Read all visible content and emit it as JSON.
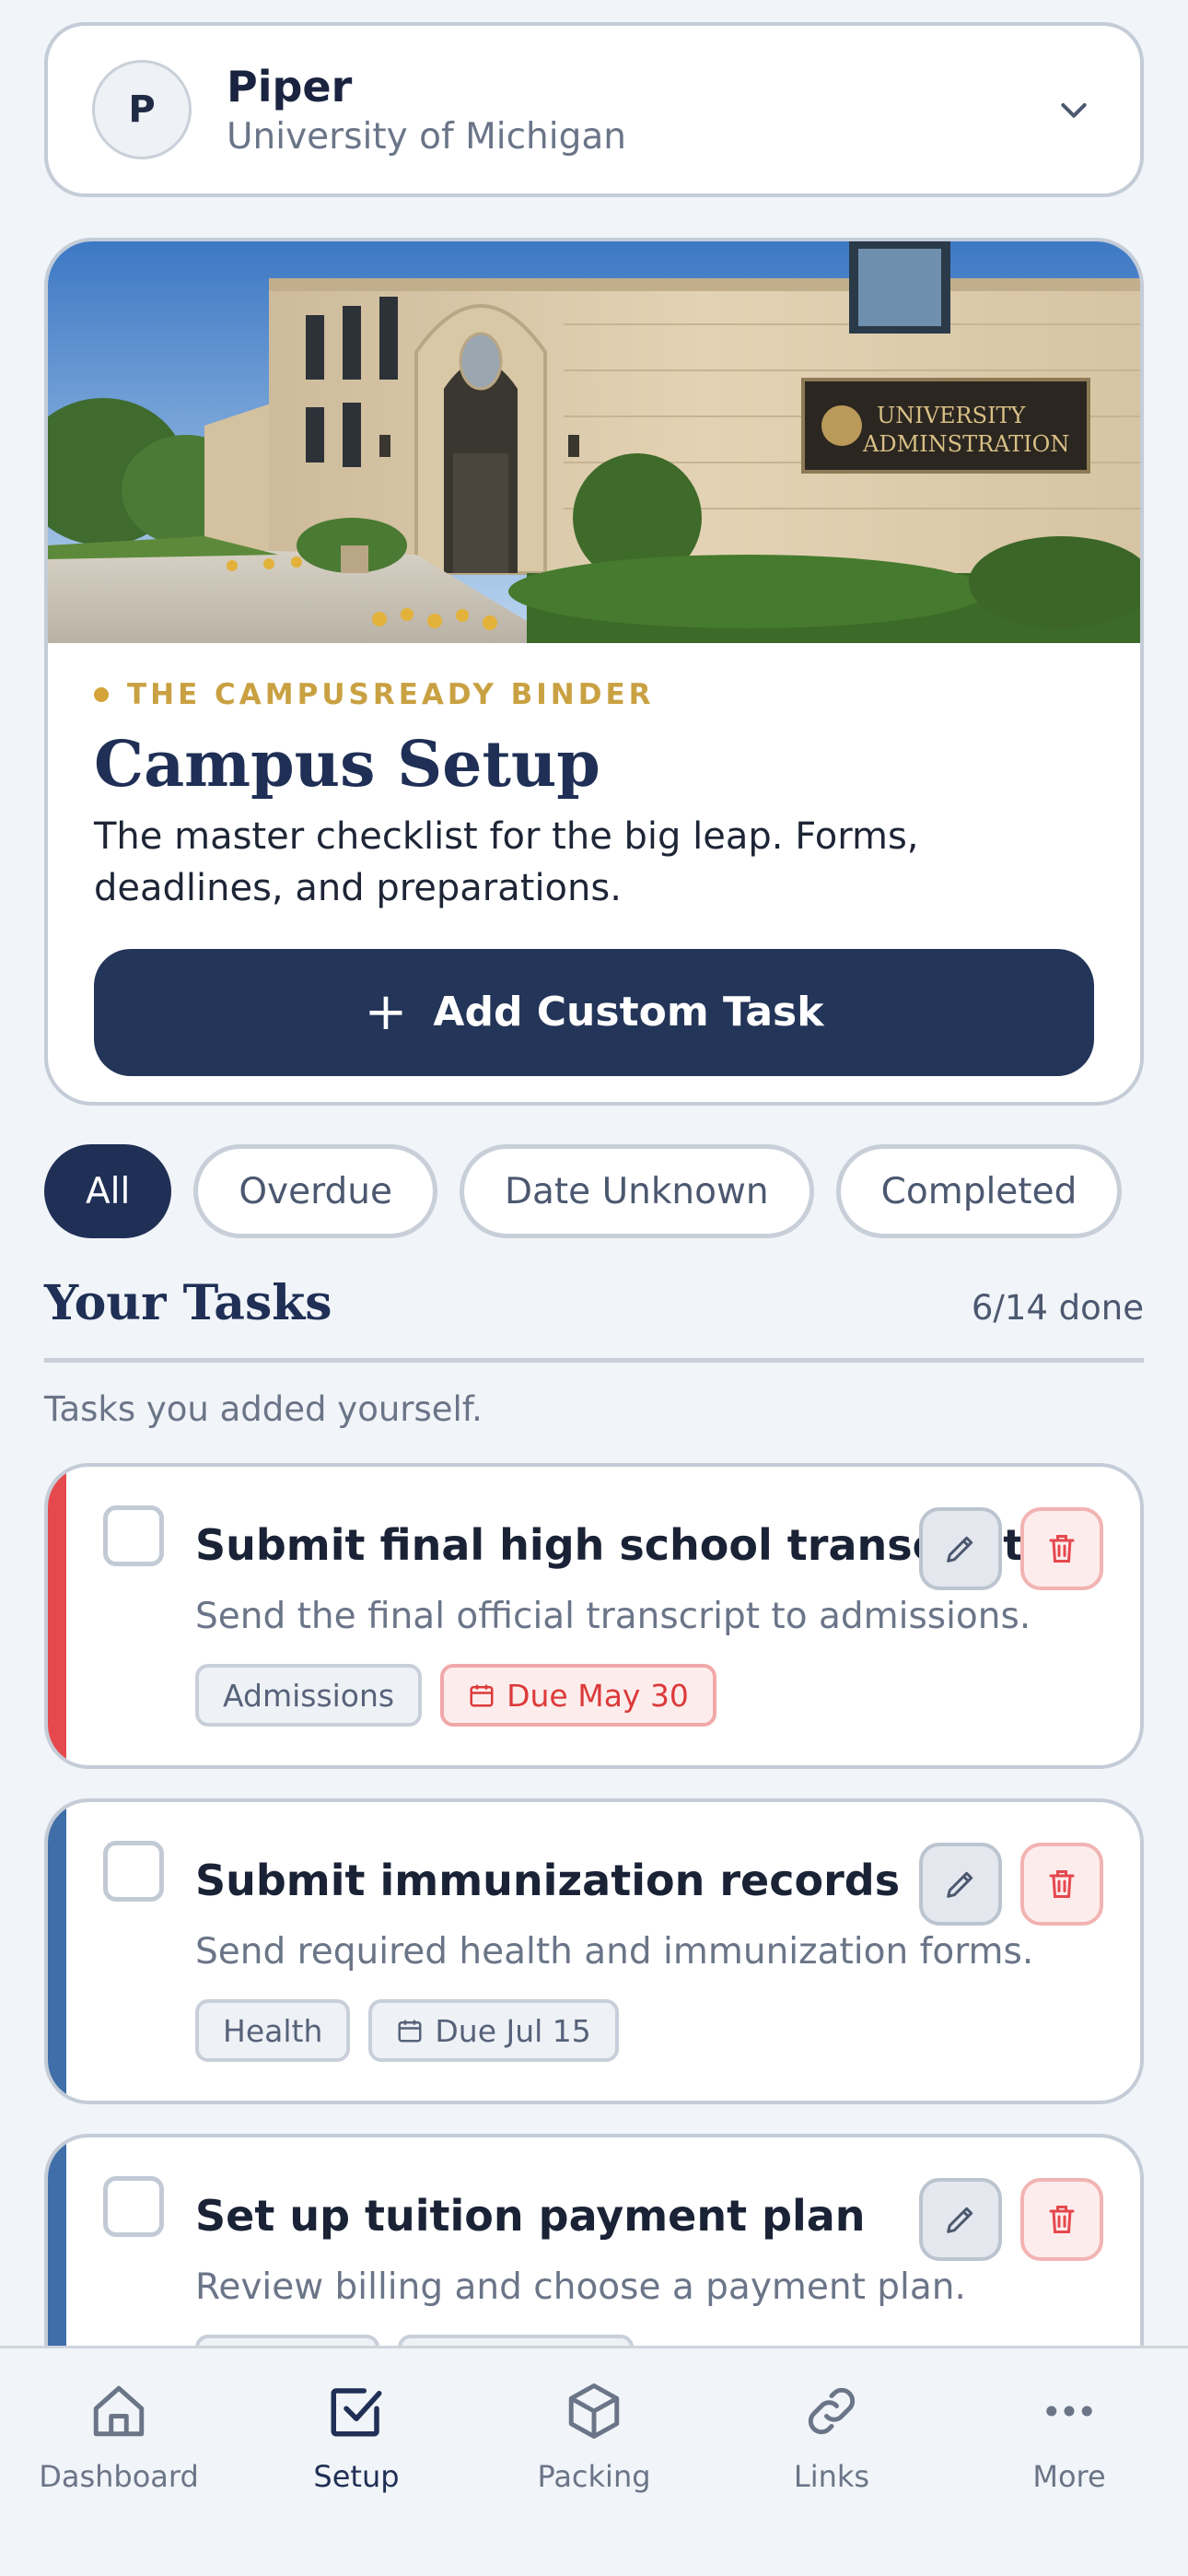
{
  "profile": {
    "initial": "P",
    "name": "Piper",
    "school": "University of Michigan"
  },
  "hero": {
    "image_sign_line1": "UNIVERSITY",
    "image_sign_line2": "ADMINSTRATION",
    "eyebrow": "THE CAMPUSREADY BINDER",
    "title": "Campus Setup",
    "description": "The master checklist for the big leap. Forms, deadlines, and preparations.",
    "add_button_label": "Add Custom Task"
  },
  "filters": {
    "items": [
      {
        "label": "All",
        "active": true
      },
      {
        "label": "Overdue",
        "active": false
      },
      {
        "label": "Date Unknown",
        "active": false
      },
      {
        "label": "Completed",
        "active": false
      }
    ]
  },
  "tasks_section": {
    "title": "Your Tasks",
    "progress": "6/14 done",
    "subtitle": "Tasks you added yourself."
  },
  "tasks": [
    {
      "title": "Submit final high school transcript",
      "description": "Send the final official transcript to admissions.",
      "category": "Admissions",
      "due": "Due May 30",
      "accent_color": "#e5484d",
      "overdue": true,
      "completed": false
    },
    {
      "title": "Submit immunization records",
      "description": "Send required health and immunization forms.",
      "category": "Health",
      "due": "Due Jul 15",
      "accent_color": "#3f6ea8",
      "overdue": false,
      "completed": false
    },
    {
      "title": "Set up tuition payment plan",
      "description": "Review billing and choose a payment plan.",
      "category": "",
      "due": "",
      "accent_color": "#3f6ea8",
      "overdue": false,
      "completed": false
    }
  ],
  "nav": {
    "items": [
      {
        "label": "Dashboard",
        "icon": "home-icon",
        "active": false
      },
      {
        "label": "Setup",
        "icon": "checkbox-icon",
        "active": true
      },
      {
        "label": "Packing",
        "icon": "box-icon",
        "active": false
      },
      {
        "label": "Links",
        "icon": "link-icon",
        "active": false
      },
      {
        "label": "More",
        "icon": "more-icon",
        "active": false
      }
    ]
  },
  "colors": {
    "navy": "#1f2f55",
    "gold": "#d4a43a",
    "danger": "#e5484d",
    "accent_blue": "#3f6ea8"
  }
}
